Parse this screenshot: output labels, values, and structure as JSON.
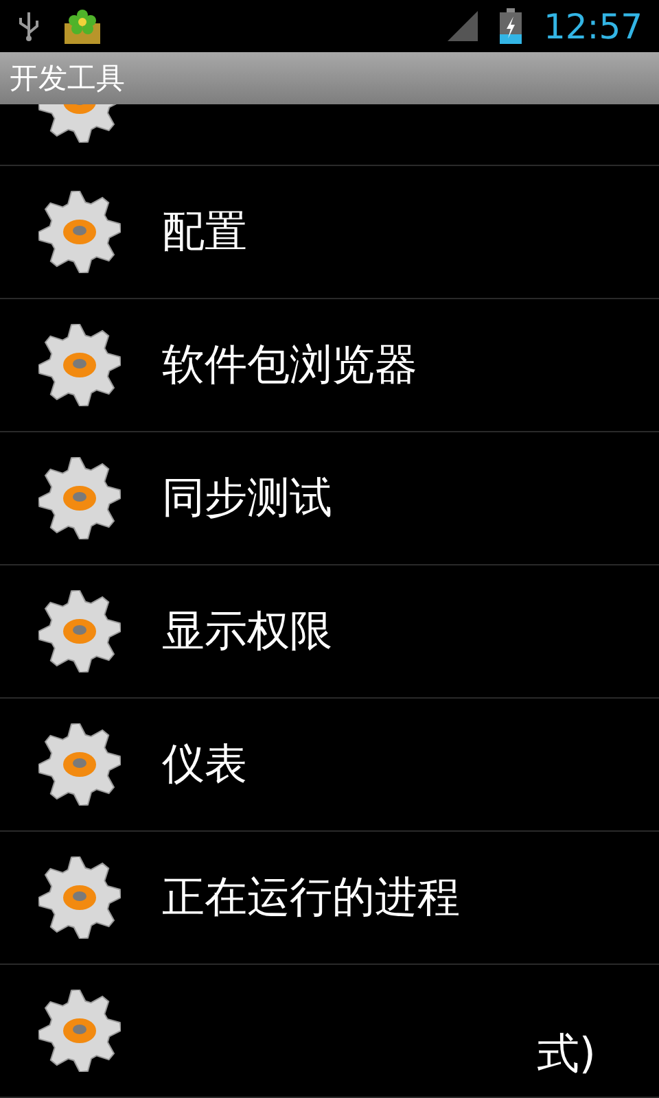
{
  "status_bar": {
    "time": "12:57"
  },
  "title": "开发工具",
  "items": [
    {
      "kind": "cut_top"
    },
    {
      "label": "配置"
    },
    {
      "label": "软件包浏览器"
    },
    {
      "label": "同步测试"
    },
    {
      "label": "显示权限"
    },
    {
      "label": "仪表"
    },
    {
      "label": "正在运行的进程"
    },
    {
      "label": "式)",
      "kind": "cut"
    }
  ]
}
